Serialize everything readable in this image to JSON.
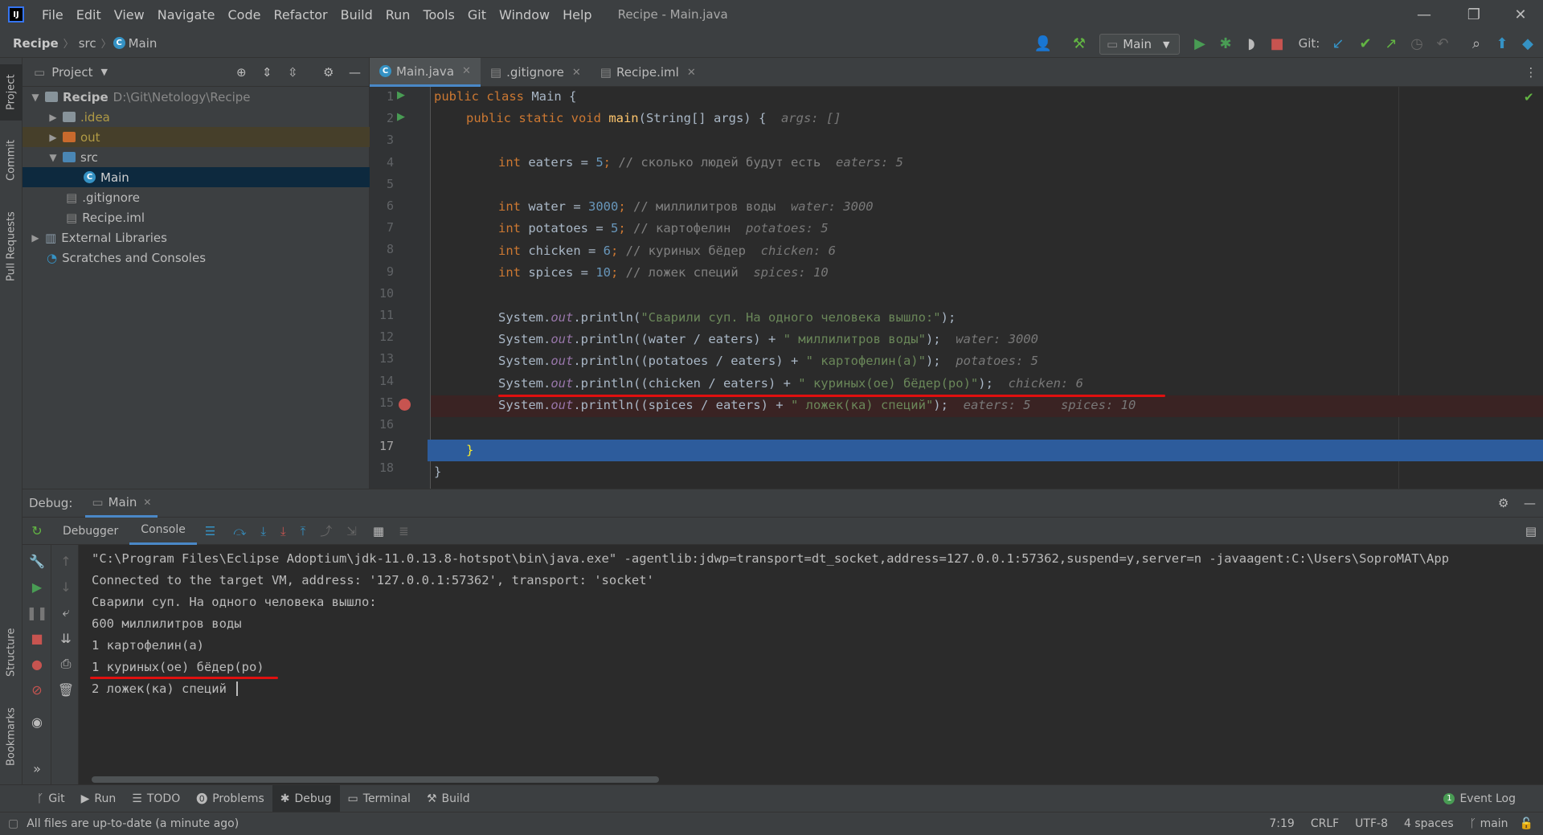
{
  "app": {
    "title": "Recipe - Main.java",
    "menu": [
      "File",
      "Edit",
      "View",
      "Navigate",
      "Code",
      "Refactor",
      "Build",
      "Run",
      "Tools",
      "Git",
      "Window",
      "Help"
    ]
  },
  "nav": {
    "project": "Recipe",
    "folder": "src",
    "file": "Main",
    "run_config": "Main",
    "git_label": "Git:"
  },
  "left_tabs": [
    "Project",
    "Commit",
    "Pull Requests",
    "Structure",
    "Bookmarks"
  ],
  "project": {
    "header": "Project",
    "tree": [
      {
        "label": "Recipe",
        "extra": "D:\\Git\\Netology\\Recipe"
      },
      {
        "label": ".idea"
      },
      {
        "label": "out"
      },
      {
        "label": "src"
      },
      {
        "label": "Main"
      },
      {
        "label": ".gitignore"
      },
      {
        "label": "Recipe.iml"
      },
      {
        "label": "External Libraries"
      },
      {
        "label": "Scratches and Consoles"
      }
    ]
  },
  "editor": {
    "tabs": [
      {
        "label": "Main.java"
      },
      {
        "label": ".gitignore"
      },
      {
        "label": "Recipe.iml"
      }
    ],
    "lines": [
      "1",
      "2",
      "3",
      "4",
      "5",
      "6",
      "7",
      "8",
      "9",
      "10",
      "11",
      "12",
      "13",
      "14",
      "15",
      "16",
      "17",
      "18"
    ],
    "code": {
      "l1a": "public class ",
      "l1b": "Main {",
      "l2a": "public static void ",
      "l2b": "main",
      "l2c": "(String[] args) {",
      "l2h": "args: []",
      "l4a": "int ",
      "l4b": "eaters = ",
      "l4c": "5",
      "l4d": "; ",
      "l4e": "// сколько людей будут есть",
      "l4h": "eaters: 5",
      "l6a": "int ",
      "l6b": "water = ",
      "l6c": "3000",
      "l6d": "; ",
      "l6e": "// миллилитров воды",
      "l6h": "water: 3000",
      "l7a": "int ",
      "l7b": "potatoes = ",
      "l7c": "5",
      "l7d": "; ",
      "l7e": "// картофелин",
      "l7h": "potatoes: 5",
      "l8a": "int ",
      "l8b": "chicken = ",
      "l8c": "6",
      "l8d": "; ",
      "l8e": "// куриных бёдер",
      "l8h": "chicken: 6",
      "l9a": "int ",
      "l9b": "spices = ",
      "l9c": "10",
      "l9d": "; ",
      "l9e": "// ложек специй",
      "l9h": "spices: 10",
      "sys": "System.",
      "out": "out",
      "pl": ".println(",
      "l11s": "\"Сварили суп. На одного человека вышло:\"",
      "l11e": ");",
      "l12a": "(water / eaters) + ",
      "l12s": "\" миллилитров воды\"",
      "l12e": ");",
      "l12h": "water: 3000",
      "l13a": "(potatoes / eaters) + ",
      "l13s": "\" картофелин(а)\"",
      "l13e": ");",
      "l13h": "potatoes: 5",
      "l14a": "(chicken / eaters) + ",
      "l14s": "\" куриных(ое) бёдер(ро)\"",
      "l14e": ");",
      "l14h": "chicken: 6",
      "l15a": "(spices / eaters) + ",
      "l15s": "\" ложек(ка) специй\"",
      "l15e": ");",
      "l15h": "eaters: 5",
      "l15h2": "spices: 10",
      "l17": "}",
      "l18": "}"
    }
  },
  "debug": {
    "label": "Debug:",
    "session": "Main",
    "tabs": [
      "Debugger",
      "Console"
    ],
    "console": [
      "\"C:\\Program Files\\Eclipse Adoptium\\jdk-11.0.13.8-hotspot\\bin\\java.exe\" -agentlib:jdwp=transport=dt_socket,address=127.0.0.1:57362,suspend=y,server=n -javaagent:C:\\Users\\SoproMAT\\App",
      "Connected to the target VM, address: '127.0.0.1:57362', transport: 'socket'",
      "Сварили суп. На одного человека вышло:",
      "600 миллилитров воды",
      "1 картофелин(а)",
      "1 куриных(ое) бёдер(ро)",
      "2 ложек(ка) специй"
    ]
  },
  "bottom_tabs": [
    "Git",
    "Run",
    "TODO",
    "Problems",
    "Debug",
    "Terminal",
    "Build"
  ],
  "event_log": "Event Log",
  "status": {
    "message": "All files are up-to-date (a minute ago)",
    "pos": "7:19",
    "eol": "CRLF",
    "enc": "UTF-8",
    "indent": "4 spaces",
    "branch": "main"
  }
}
